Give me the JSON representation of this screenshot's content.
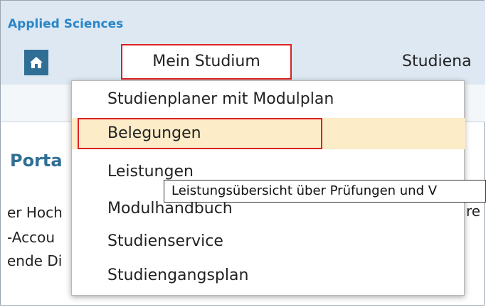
{
  "header": {
    "brand": "Applied Sciences",
    "home_icon": "home-icon",
    "nav": [
      "Mein Studium",
      "Studiena"
    ]
  },
  "background": {
    "portal_title": "Porta",
    "lines": [
      "er Hoch",
      "-Accou",
      "ende Di"
    ],
    "right_fragment": "re"
  },
  "dropdown": {
    "items": [
      "Studienplaner mit Modulplan",
      "Belegungen",
      "Leistungen",
      "Modulhandbuch",
      "Studienservice",
      "Studiengangsplan"
    ],
    "highlighted": "Belegungen"
  },
  "tooltip": {
    "text": "Leistungsübersicht über Prüfungen und V"
  },
  "colors": {
    "brand": "#2a86c8",
    "home_bg": "#2f6f95",
    "highlight": "#fdecc8",
    "annotation_red": "#e02020"
  }
}
